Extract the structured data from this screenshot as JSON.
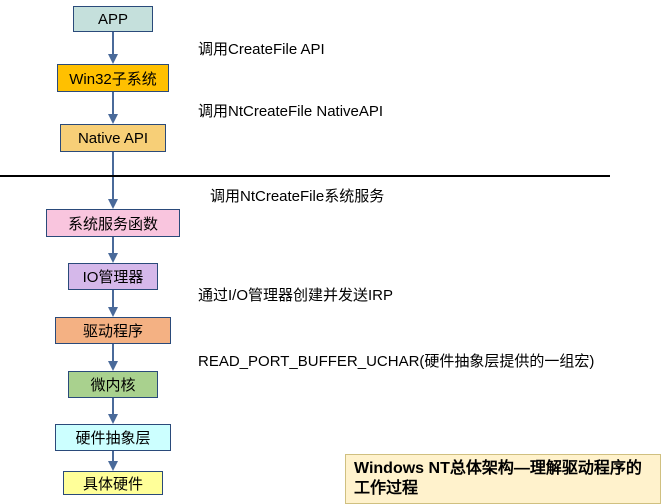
{
  "boxes": {
    "app": {
      "label": "APP",
      "bg": "#c5e0dc"
    },
    "win32": {
      "label": "Win32子系统",
      "bg": "#ffc000"
    },
    "native": {
      "label": "Native API",
      "bg": "#f7cf77"
    },
    "svc": {
      "label": "系统服务函数",
      "bg": "#f9c5de"
    },
    "iomgr": {
      "label": "IO管理器",
      "bg": "#d5b8ea"
    },
    "driver": {
      "label": "驱动程序",
      "bg": "#f4b183"
    },
    "kernel": {
      "label": "微内核",
      "bg": "#a9d18e"
    },
    "hal": {
      "label": "硬件抽象层",
      "bg": "#ccffff"
    },
    "hw": {
      "label": "具体硬件",
      "bg": "#ffff99"
    }
  },
  "labels": {
    "l1": "调用CreateFile API",
    "l2": "调用NtCreateFile NativeAPI",
    "l3": "调用NtCreateFile系统服务",
    "l4": "通过I/O管理器创建并发送IRP",
    "l5": "READ_PORT_BUFFER_UCHAR(硬件抽象层提供的一组宏)"
  },
  "caption": "Windows NT总体架构—理解驱动程序的工作过程"
}
